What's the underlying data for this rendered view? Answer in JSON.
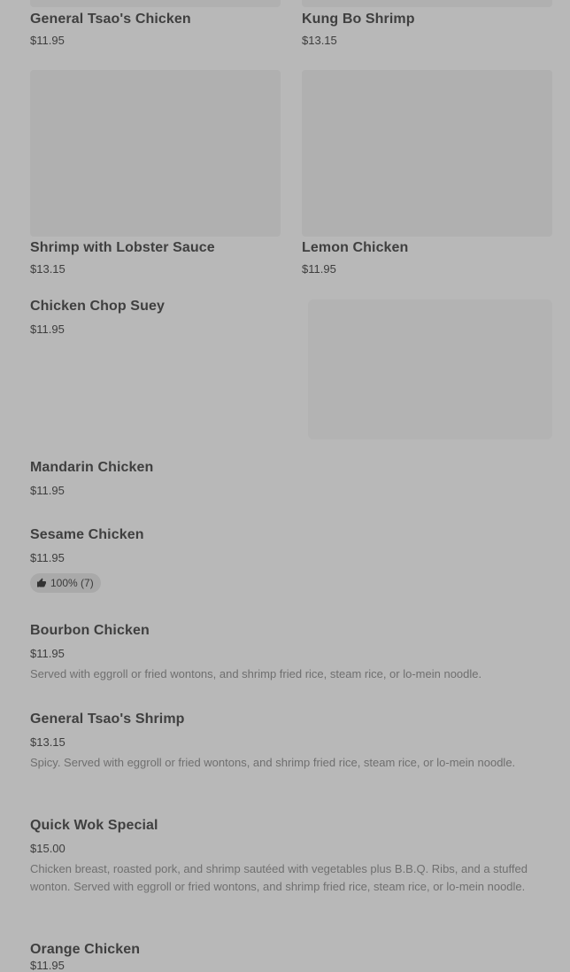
{
  "menu": {
    "items": [
      {
        "name": "General Tsao's Chicken",
        "price": "$11.95"
      },
      {
        "name": "Kung Bo Shrimp",
        "price": "$13.15"
      },
      {
        "name": "Shrimp with Lobster Sauce",
        "price": "$13.15"
      },
      {
        "name": "Lemon Chicken",
        "price": "$11.95"
      },
      {
        "name": "Chicken Chop Suey",
        "price": "$11.95"
      },
      {
        "name": "Mandarin Chicken",
        "price": "$11.95"
      },
      {
        "name": "Sesame Chicken",
        "price": "$11.95",
        "rating": "100% (7)"
      },
      {
        "name": "Bourbon Chicken",
        "price": "$11.95",
        "description": "Served with eggroll or fried wontons, and shrimp fried rice, steam rice, or lo-mein noodle."
      },
      {
        "name": "General Tsao's Shrimp",
        "price": "$13.15",
        "description": "Spicy. Served with eggroll or fried wontons, and shrimp fried rice, steam rice, or lo-mein noodle."
      },
      {
        "name": "Quick Wok Special",
        "price": "$15.00",
        "description": "Chicken breast, roasted pork, and shrimp sautéed with vegetables plus B.B.Q. Ribs, and a stuffed wonton. Served with eggroll or fried wontons, and shrimp fried rice, steam rice, or lo-mein noodle."
      },
      {
        "name": "Orange Chicken",
        "price": "$11.95"
      }
    ]
  },
  "icons": {
    "rating": "thumbs-up-icon"
  }
}
